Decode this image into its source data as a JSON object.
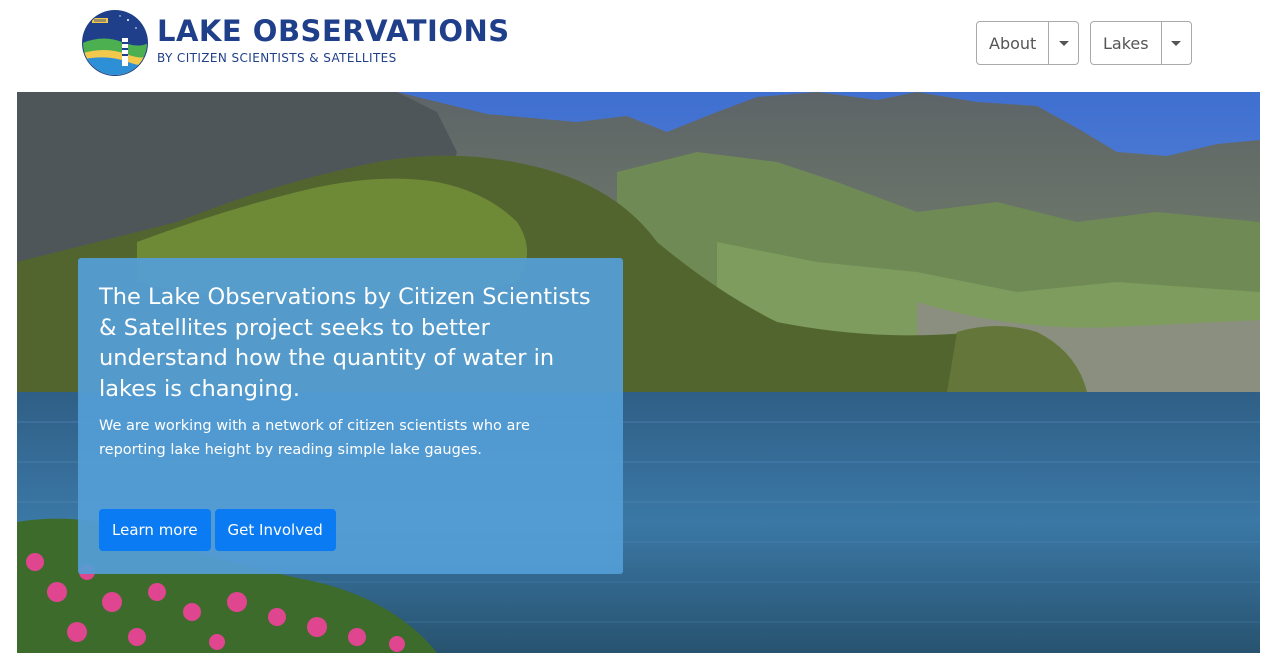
{
  "brand": {
    "title": "LAKE OBSERVATIONS",
    "subtitle": "BY CITIZEN SCIENTISTS & SATELLITES"
  },
  "nav": {
    "about_label": "About",
    "lakes_label": "Lakes"
  },
  "hero": {
    "heading": "The Lake Observations by Citizen Scientists & Satellites project seeks to better understand how the quantity of water in lakes is changing.",
    "body": "We are working with a network of citizen scientists who are reporting lake height by reading simple lake gauges.",
    "learn_more_label": "Learn more",
    "get_involved_label": "Get Involved"
  },
  "colors": {
    "brand_navy": "#1f3f8a",
    "callout_blue": "#549ed6",
    "button_blue": "#0a7bf3"
  },
  "icons": {
    "logo": "satellite-lake-gauge-logo",
    "dropdown": "caret-down-icon"
  }
}
